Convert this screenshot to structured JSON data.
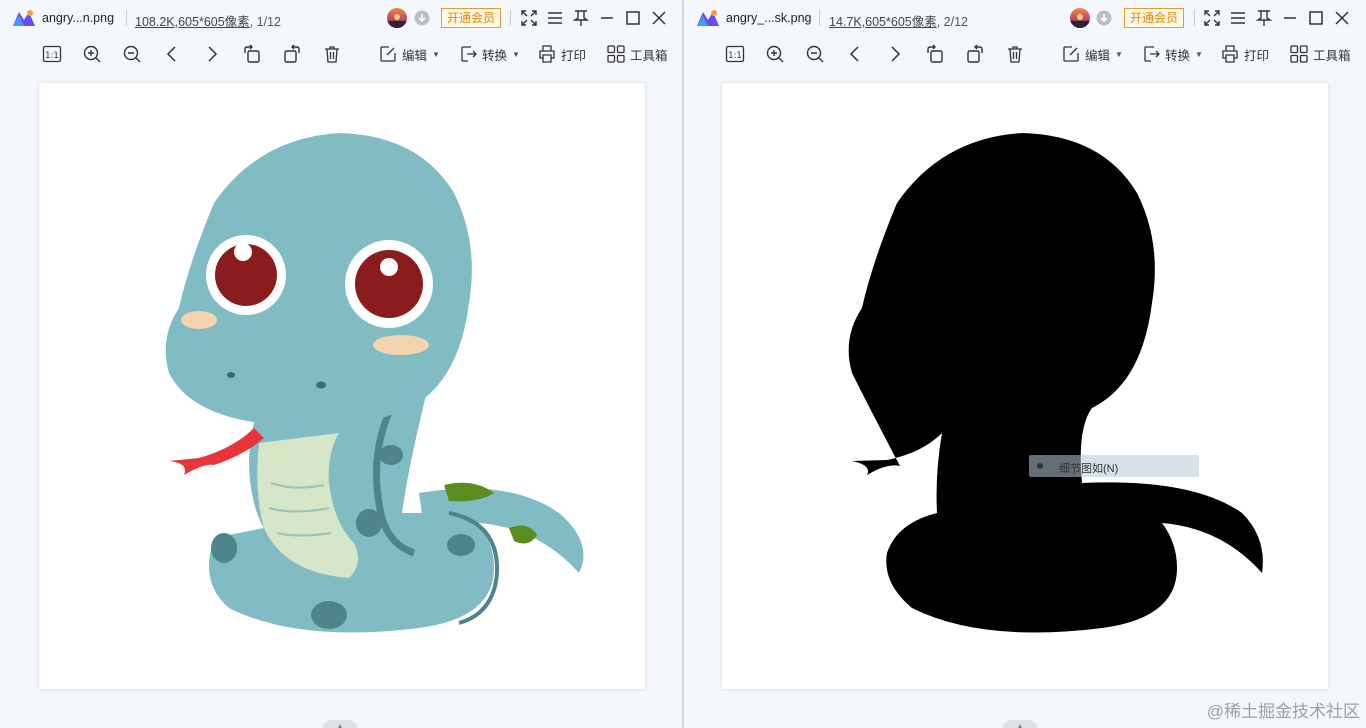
{
  "windows": [
    {
      "filename": "angry...n.png",
      "filesize": "108.2K",
      "dimensions": ",605*605像素",
      "page": ", 1/12",
      "vip_label": "开通会员",
      "toolbar": {
        "edit": "编辑",
        "convert": "转换",
        "print": "打印",
        "toolbox": "工具箱"
      },
      "image": "cartoon-snake"
    },
    {
      "filename": "angry_...sk.png",
      "filesize": "14.7K",
      "dimensions": ",605*605像素",
      "page": ", 2/12",
      "vip_label": "开通会员",
      "toolbar": {
        "edit": "编辑",
        "convert": "转换",
        "print": "打印",
        "toolbox": "工具箱"
      },
      "image": "snake-mask-silhouette",
      "tooltip": "细节图如(N)"
    }
  ],
  "watermark": "@稀土掘金技术社区",
  "colors": {
    "snake_body": "#81bcc4",
    "snake_dark": "#4f848a",
    "eye": "#8b1c1c",
    "tongue": "#e8343a",
    "belly": "#d6e6c8",
    "spot_green": "#5b8c20",
    "vip": "#e08a00",
    "mask": "#000000"
  },
  "icons": [
    "app-logo-icon",
    "avatar-icon",
    "download-icon",
    "fullscreen-icon",
    "menu-icon",
    "pin-icon",
    "minimize-icon",
    "maximize-icon",
    "close-icon",
    "actual-size-icon",
    "zoom-in-icon",
    "zoom-out-icon",
    "prev-icon",
    "next-icon",
    "rotate-left-icon",
    "rotate-right-icon",
    "delete-icon",
    "edit-icon",
    "convert-icon",
    "print-icon",
    "toolbox-icon"
  ]
}
